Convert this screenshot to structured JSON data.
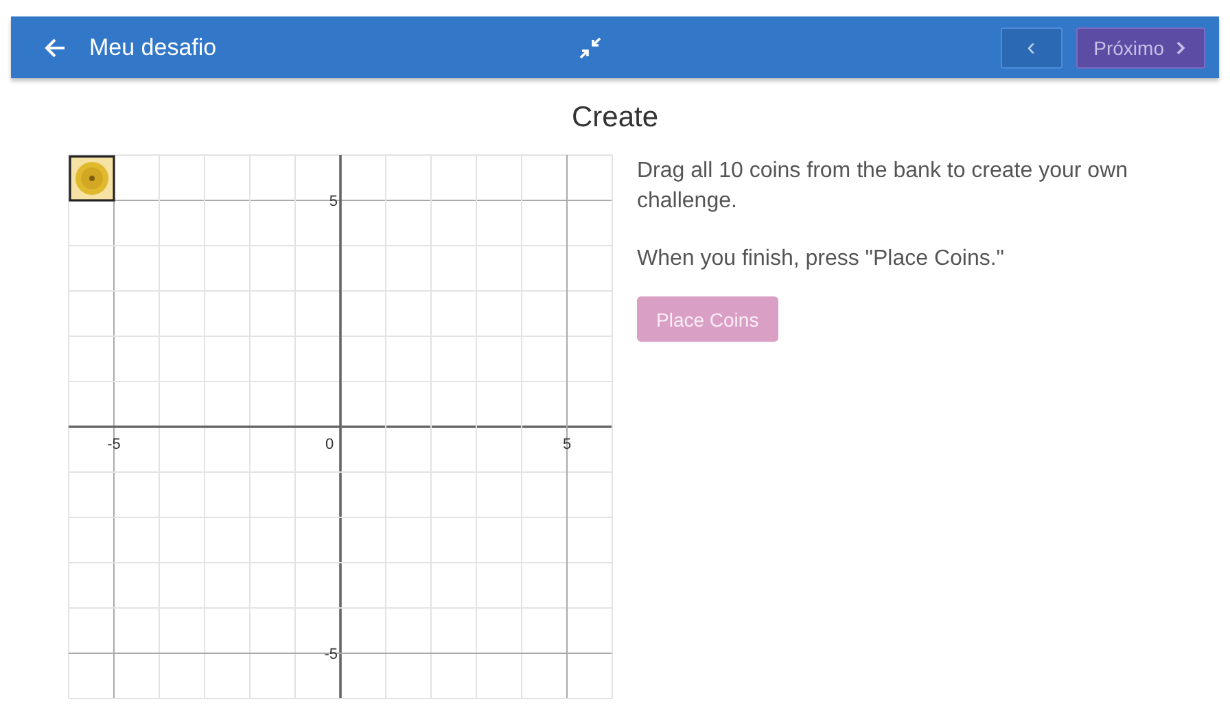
{
  "header": {
    "title": "Meu desafio",
    "prev_button": {
      "label": "‹",
      "disabled": true
    },
    "next_button": {
      "label": "Próximo",
      "disabled": true
    }
  },
  "page_title": "Create",
  "graph": {
    "x_tick_labels": [
      "-5",
      "0",
      "5"
    ],
    "y_tick_labels": [
      "5",
      "-5"
    ]
  },
  "instructions": [
    "Drag all 10 coins from the bank to create your own challenge.",
    "When you finish, press \"Place Coins.\""
  ],
  "place_button": {
    "label": "Place Coins",
    "disabled": true
  }
}
